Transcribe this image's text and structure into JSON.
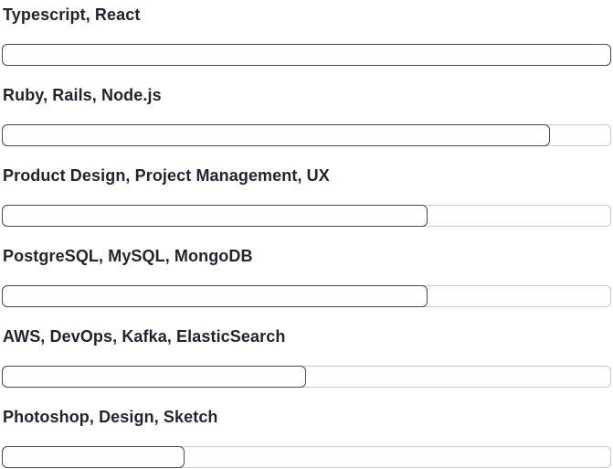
{
  "skills": [
    {
      "label": "Typescript, React",
      "level": 1.0
    },
    {
      "label": "Ruby, Rails, Node.js",
      "level": 0.9
    },
    {
      "label": "Product Design, Project Management, UX",
      "level": 0.7
    },
    {
      "label": "PostgreSQL, MySQL, MongoDB",
      "level": 0.7
    },
    {
      "label": "AWS, DevOps, Kafka, ElasticSearch",
      "level": 0.5
    },
    {
      "label": "Photoshop, Design, Sketch",
      "level": 0.3
    }
  ],
  "colors": {
    "text": "#1f2430",
    "fill_border": "#4a4a4a",
    "track_border": "#c4cad8"
  }
}
